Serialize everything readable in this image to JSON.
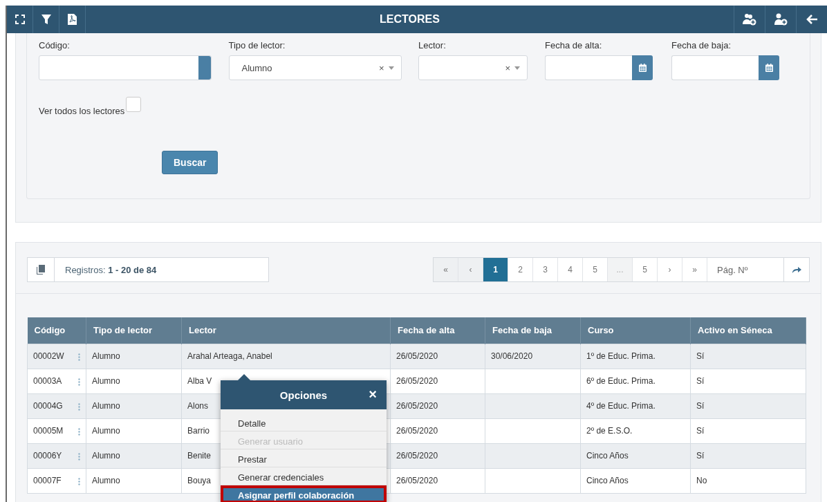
{
  "header": {
    "title": "LECTORES",
    "left_tools": [
      {
        "kind": "expand"
      },
      {
        "kind": "filter"
      },
      {
        "kind": "pdf"
      }
    ],
    "right_tools": [
      {
        "kind": "group-add"
      },
      {
        "kind": "user-add"
      },
      {
        "kind": "back"
      }
    ]
  },
  "filters": [
    {
      "kind": "text",
      "label": "Código:"
    },
    {
      "kind": "select",
      "label": "Tipo de lector:",
      "value": "Alumno",
      "clear": "×"
    },
    {
      "kind": "select",
      "label": "Lector:",
      "clear": "×"
    },
    {
      "kind": "date",
      "label": "Fecha de alta:"
    },
    {
      "kind": "date",
      "label": "Fecha de baja:"
    }
  ],
  "show_all": {
    "label": "Ver todos los lectores",
    "checked": false
  },
  "search_button": "Buscar",
  "records": {
    "label": "Registros:",
    "range": "1 - 20 de 84"
  },
  "pagination": [
    {
      "kind": "nav",
      "text": "«",
      "selected": false
    },
    {
      "kind": "nav",
      "text": "‹",
      "selected": false
    },
    {
      "kind": "page",
      "text": "1",
      "selected": true
    },
    {
      "kind": "page",
      "text": "2",
      "selected": false
    },
    {
      "kind": "page",
      "text": "3",
      "selected": false
    },
    {
      "kind": "page",
      "text": "4",
      "selected": false
    },
    {
      "kind": "page",
      "text": "5",
      "selected": false
    },
    {
      "kind": "ellipsis",
      "text": "...",
      "selected": false
    },
    {
      "kind": "page",
      "text": "5",
      "selected": false
    },
    {
      "kind": "nav",
      "text": "›",
      "selected": false
    },
    {
      "kind": "nav",
      "text": "»",
      "selected": false
    }
  ],
  "page_input": {
    "placeholder": "Pág. Nº"
  },
  "table": {
    "columns": [
      "Código",
      "Tipo de lector",
      "Lector",
      "Fecha de alta",
      "Fecha de baja",
      "Curso",
      "Activo en Séneca"
    ],
    "rows": [
      [
        "00002W",
        "Alumno",
        "Arahal Arteaga, Anabel",
        "26/05/2020",
        "30/06/2020",
        "1º de Educ. Prima.",
        "Sí"
      ],
      [
        "00003A",
        "Alumno",
        "Alba V",
        "26/05/2020",
        "",
        "6º de Educ. Prima.",
        "Sí"
      ],
      [
        "00004G",
        "Alumno",
        "Alons",
        "26/05/2020",
        "",
        "4º de Educ. Prima.",
        "Sí"
      ],
      [
        "00005M",
        "Alumno",
        "Barrio",
        "26/05/2020",
        "",
        "2º de E.S.O.",
        "Sí"
      ],
      [
        "00006Y",
        "Alumno",
        "Benite",
        "26/05/2020",
        "",
        "Cinco Años",
        "Sí"
      ],
      [
        "00007F",
        "Alumno",
        "Bouya",
        "26/05/2020",
        "",
        "Cinco Años",
        "No"
      ]
    ]
  },
  "options_menu": {
    "title": "Opciones",
    "close": "×",
    "items": [
      {
        "label": "Detalle",
        "disabled": false,
        "selected": false
      },
      {
        "label": "Generar usuario",
        "disabled": true,
        "selected": false
      },
      {
        "label": "Prestar",
        "disabled": false,
        "selected": false
      },
      {
        "label": "Generar credenciales",
        "disabled": false,
        "selected": false
      },
      {
        "label": "Asignar perfil colaboración",
        "disabled": false,
        "selected": true
      }
    ]
  }
}
